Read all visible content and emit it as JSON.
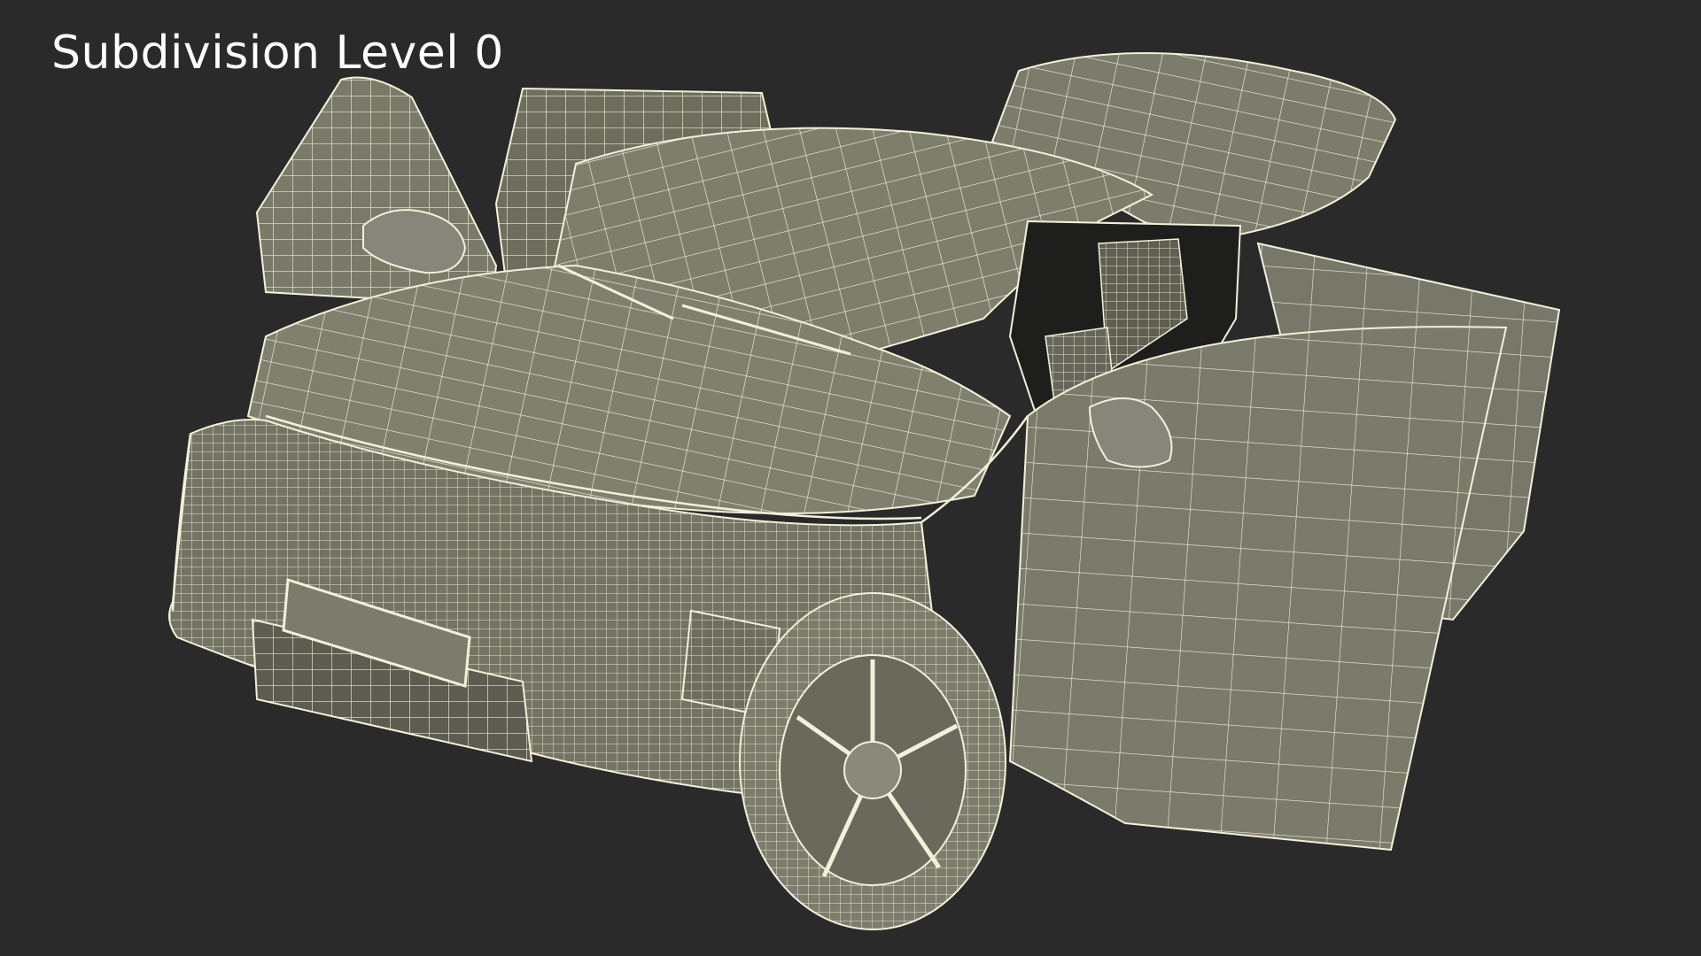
{
  "viewport": {
    "label": "Subdivision Level 0",
    "colors": {
      "background": "#2a2a2a",
      "surface": "#7c7c6c",
      "surface_dark": "#636355",
      "surface_light": "#8f8f7e",
      "wire": "#f3f0da",
      "shadow": "#4b4b42",
      "interior": "#1e1e1c"
    }
  }
}
